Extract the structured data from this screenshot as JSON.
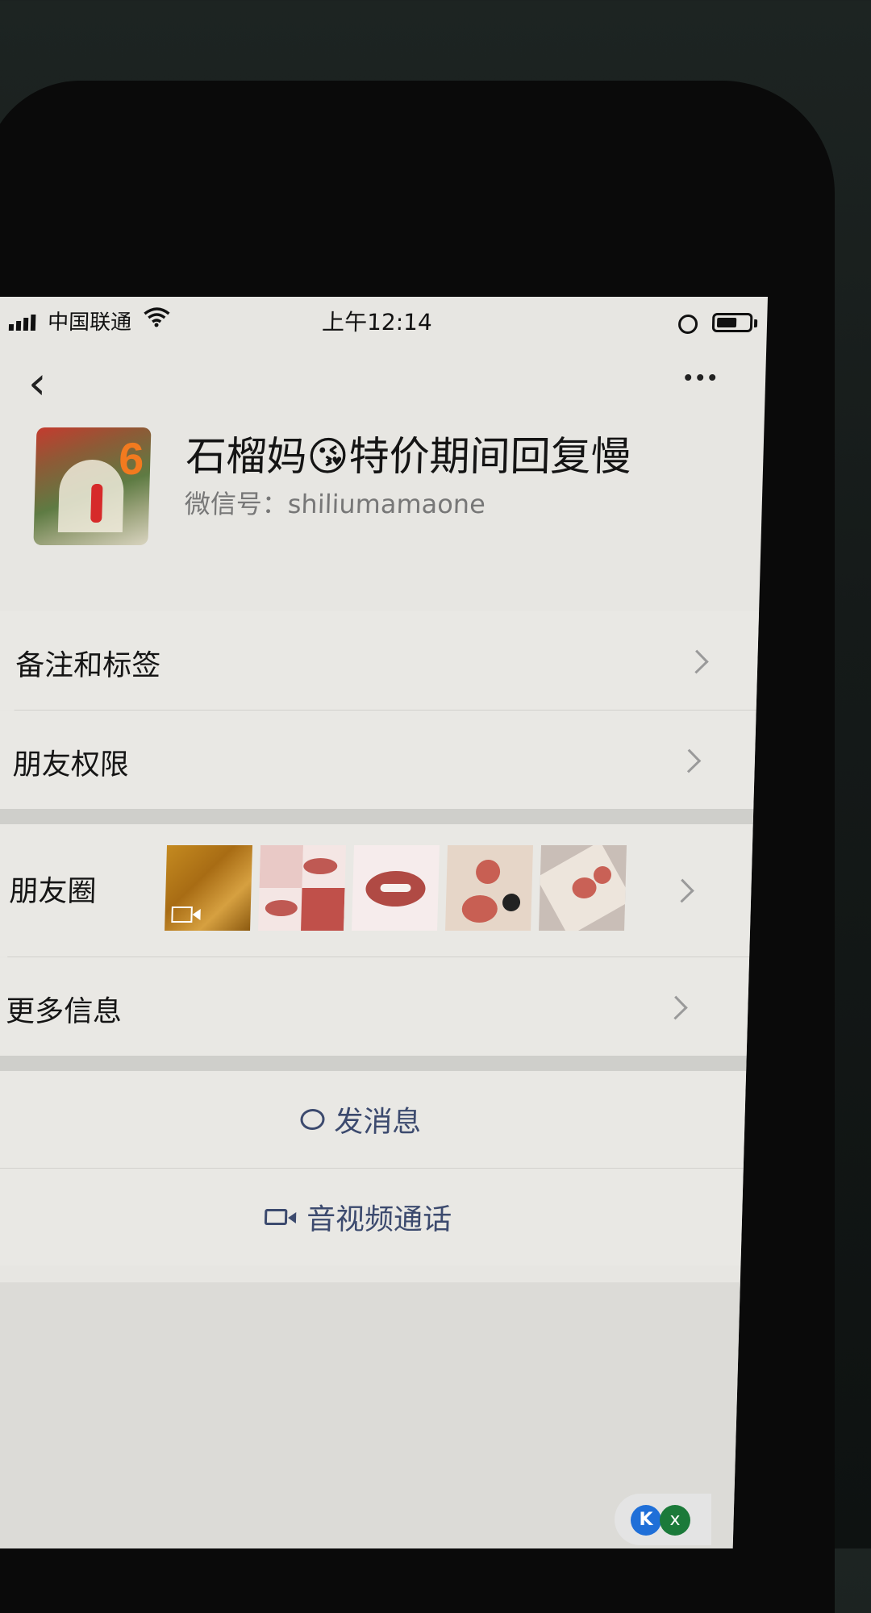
{
  "status_bar": {
    "carrier": "中国联通",
    "time": "上午12:14"
  },
  "profile": {
    "avatar_number": "6",
    "name": "石榴妈😘特价期间回复慢",
    "wechat_id": "微信号：shiliumamaone"
  },
  "menu": {
    "notes_tags": "备注和标签",
    "friend_permissions": "朋友权限",
    "moments": "朋友圈",
    "more_info": "更多信息"
  },
  "actions": {
    "send_message": "发消息",
    "av_call": "音视频通话"
  },
  "overlay": {
    "badge_left": "K",
    "badge_right": "x"
  }
}
